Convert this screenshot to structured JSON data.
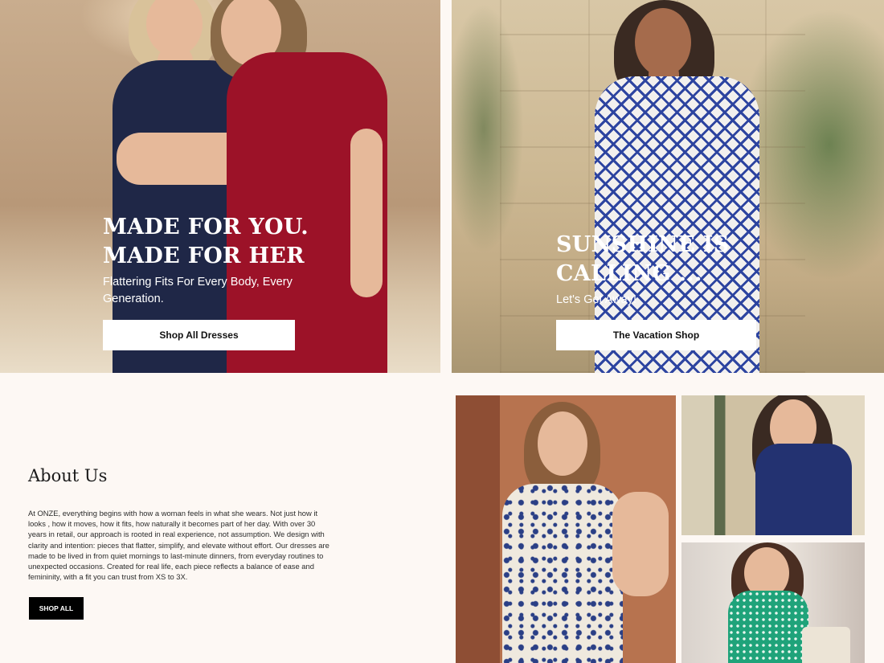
{
  "hero_left": {
    "title_line1": "MADE FOR YOU.",
    "title_line2": "MADE FOR HER",
    "subtitle": "Flattering Fits For Every Body, Every Generation.",
    "button_label": "Shop All Dresses"
  },
  "hero_right": {
    "title_line1": "SUNSHINE IS",
    "title_line2": "CALLING ...",
    "subtitle": "Let's Get Away!",
    "button_label": "The Vacation Shop"
  },
  "about": {
    "title": "About Us",
    "body": "At ONZE, everything begins with how a woman feels in what she wears. Not just how it looks , how it moves, how it fits, how naturally it becomes part of her day. With over 30 years in retail, our approach is rooted in real experience, not assumption. We design with clarity and intention: pieces that flatter, simplify, and elevate without effort. Our dresses are made to be lived in from quiet mornings to last-minute dinners, from everyday routines to unexpected occasions. Created for real life, each piece reflects a balance of ease and femininity, with a fit you can trust from XS to 3X.",
    "button_label": "SHOP ALL"
  },
  "colors": {
    "page_bg": "#fdf8f4",
    "button_dark": "#000000",
    "button_light": "#ffffff"
  }
}
